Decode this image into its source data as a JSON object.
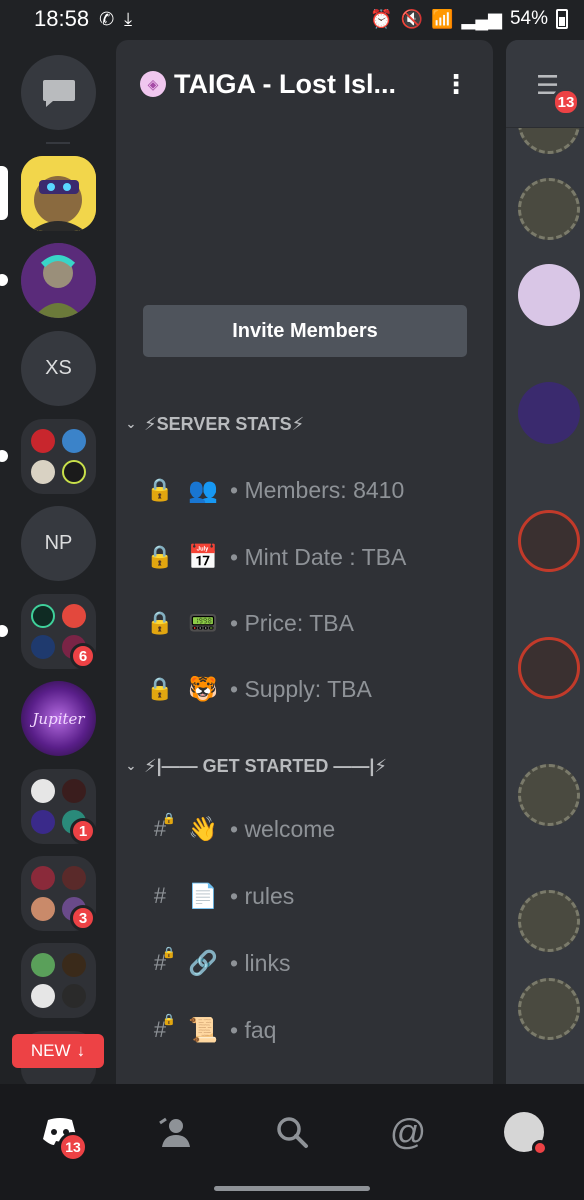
{
  "status_bar": {
    "time": "18:58",
    "battery": "54%",
    "left_icons": [
      "messenger-icon",
      "download-icon"
    ],
    "right_icons": [
      "alarm-icon",
      "mute-icon",
      "wifi-icon",
      "signal-icon",
      "battery-icon"
    ]
  },
  "servers": {
    "items": [
      {
        "name": "direct-messages",
        "icon": "chat-icon"
      },
      {
        "name": "taiga-server",
        "selected": true
      },
      {
        "name": "ape-server"
      },
      {
        "name": "xs-server",
        "initials": "XS"
      },
      {
        "name": "folder-1"
      },
      {
        "name": "np-server",
        "initials": "NP"
      },
      {
        "name": "folder-2",
        "badge": "6"
      },
      {
        "name": "jupiter-server",
        "label": "Jupiter"
      },
      {
        "name": "folder-3",
        "badge": "1"
      },
      {
        "name": "folder-4",
        "badge": "3"
      },
      {
        "name": "folder-5"
      }
    ],
    "new_pill": "NEW"
  },
  "server_header": {
    "name": "TAIGA - Lost Isl..."
  },
  "invite_button": "Invite Members",
  "categories": [
    {
      "label": "⚡SERVER STATS⚡",
      "channels": [
        {
          "type": "locked",
          "emoji": "👥",
          "name": "• Members: 8410"
        },
        {
          "type": "locked",
          "emoji": "📅",
          "name": "• Mint Date : TBA"
        },
        {
          "type": "locked",
          "emoji": "📟",
          "name": "• Price: TBA"
        },
        {
          "type": "locked",
          "emoji": "🐯",
          "name": "• Supply: TBA"
        }
      ]
    },
    {
      "label": "⚡|—— GET STARTED ——|⚡",
      "channels": [
        {
          "type": "text-locked",
          "emoji": "👋",
          "name": "• welcome"
        },
        {
          "type": "text",
          "emoji": "📄",
          "name": "• rules"
        },
        {
          "type": "text-locked",
          "emoji": "🔗",
          "name": "• links"
        },
        {
          "type": "text-locked",
          "emoji": "📜",
          "name": "• faq"
        }
      ]
    }
  ],
  "right_column": {
    "badge": "13"
  },
  "bottom_nav": {
    "home_badge": "13",
    "items": [
      "discord-home-icon",
      "friends-icon",
      "search-icon",
      "mentions-icon",
      "profile-avatar"
    ]
  },
  "colors": {
    "background": "#202225",
    "panel": "#2f3136",
    "accent_red": "#ed4245",
    "button": "#4f545c"
  }
}
